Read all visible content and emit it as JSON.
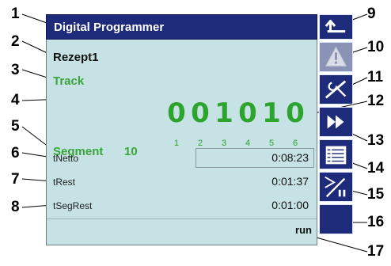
{
  "window": {
    "title": "Digital Programmer"
  },
  "recipe": "Rezept1",
  "track": {
    "label": "Track",
    "digits": [
      "0",
      "0",
      "1",
      "0",
      "1",
      "0"
    ],
    "positions": [
      "1",
      "2",
      "3",
      "4",
      "5",
      "6"
    ]
  },
  "segment": {
    "label": "Segment",
    "value": "10"
  },
  "times": [
    {
      "label": "tNetto",
      "value": "0:08:23"
    },
    {
      "label": "tRest",
      "value": "0:01:37"
    },
    {
      "label": "tSegRest",
      "value": "0:01:00"
    }
  ],
  "status": "run",
  "buttons": [
    {
      "icon": "return-arrow-icon"
    },
    {
      "icon": "warning-triangle-icon"
    },
    {
      "icon": "tools-icon"
    },
    {
      "icon": "fast-forward-icon"
    },
    {
      "icon": "list-icon"
    },
    {
      "icon": "play-pause-icon"
    },
    {
      "icon": "blank-icon"
    }
  ],
  "callouts": [
    "1",
    "2",
    "3",
    "4",
    "5",
    "6",
    "7",
    "8",
    "9",
    "10",
    "11",
    "12",
    "13",
    "14",
    "15",
    "16",
    "17"
  ],
  "colors": {
    "title_bar": "#1e2b7a",
    "panel": "#c6e2e4",
    "green_text": "#2da42d"
  }
}
